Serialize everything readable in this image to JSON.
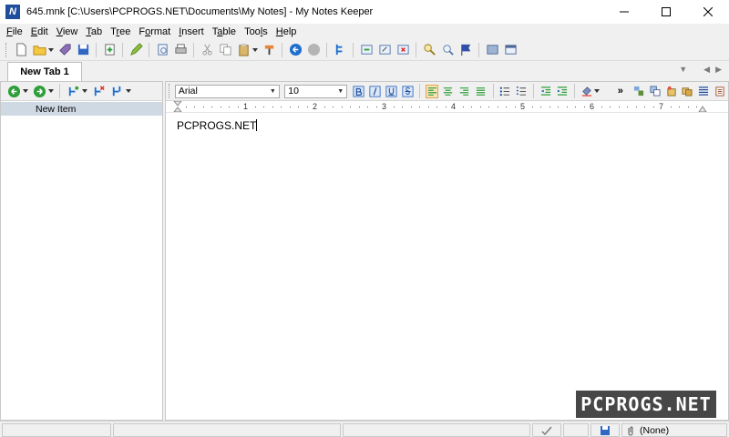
{
  "window": {
    "title": "645.mnk [C:\\Users\\PCPROGS.NET\\Documents\\My Notes] - My Notes Keeper",
    "icon_letter": "N"
  },
  "menu": [
    {
      "pre": "",
      "key": "F",
      "post": "ile"
    },
    {
      "pre": "",
      "key": "E",
      "post": "dit"
    },
    {
      "pre": "",
      "key": "V",
      "post": "iew"
    },
    {
      "pre": "",
      "key": "T",
      "post": "ab"
    },
    {
      "pre": "T",
      "key": "r",
      "post": "ee"
    },
    {
      "pre": "F",
      "key": "o",
      "post": "rmat"
    },
    {
      "pre": "",
      "key": "I",
      "post": "nsert"
    },
    {
      "pre": "T",
      "key": "a",
      "post": "ble"
    },
    {
      "pre": "Too",
      "key": "l",
      "post": "s"
    },
    {
      "pre": "",
      "key": "H",
      "post": "elp"
    }
  ],
  "tabs": {
    "active": "New Tab 1"
  },
  "tree": {
    "items": [
      "New Item"
    ]
  },
  "format": {
    "font": "Arial",
    "size": "10"
  },
  "ruler": {
    "numbers": [
      "1",
      "2",
      "3",
      "4",
      "5",
      "6",
      "7"
    ]
  },
  "document": {
    "text": "PCPROGS.NET"
  },
  "status": {
    "attachment": "(None)"
  },
  "watermark": "PCPROGS.NET",
  "colors": {
    "accent_blue": "#1f6fd1",
    "green": "#2e9e3a",
    "tree_selected": "#cfd9e3",
    "active_button": "#fbe3b8"
  }
}
